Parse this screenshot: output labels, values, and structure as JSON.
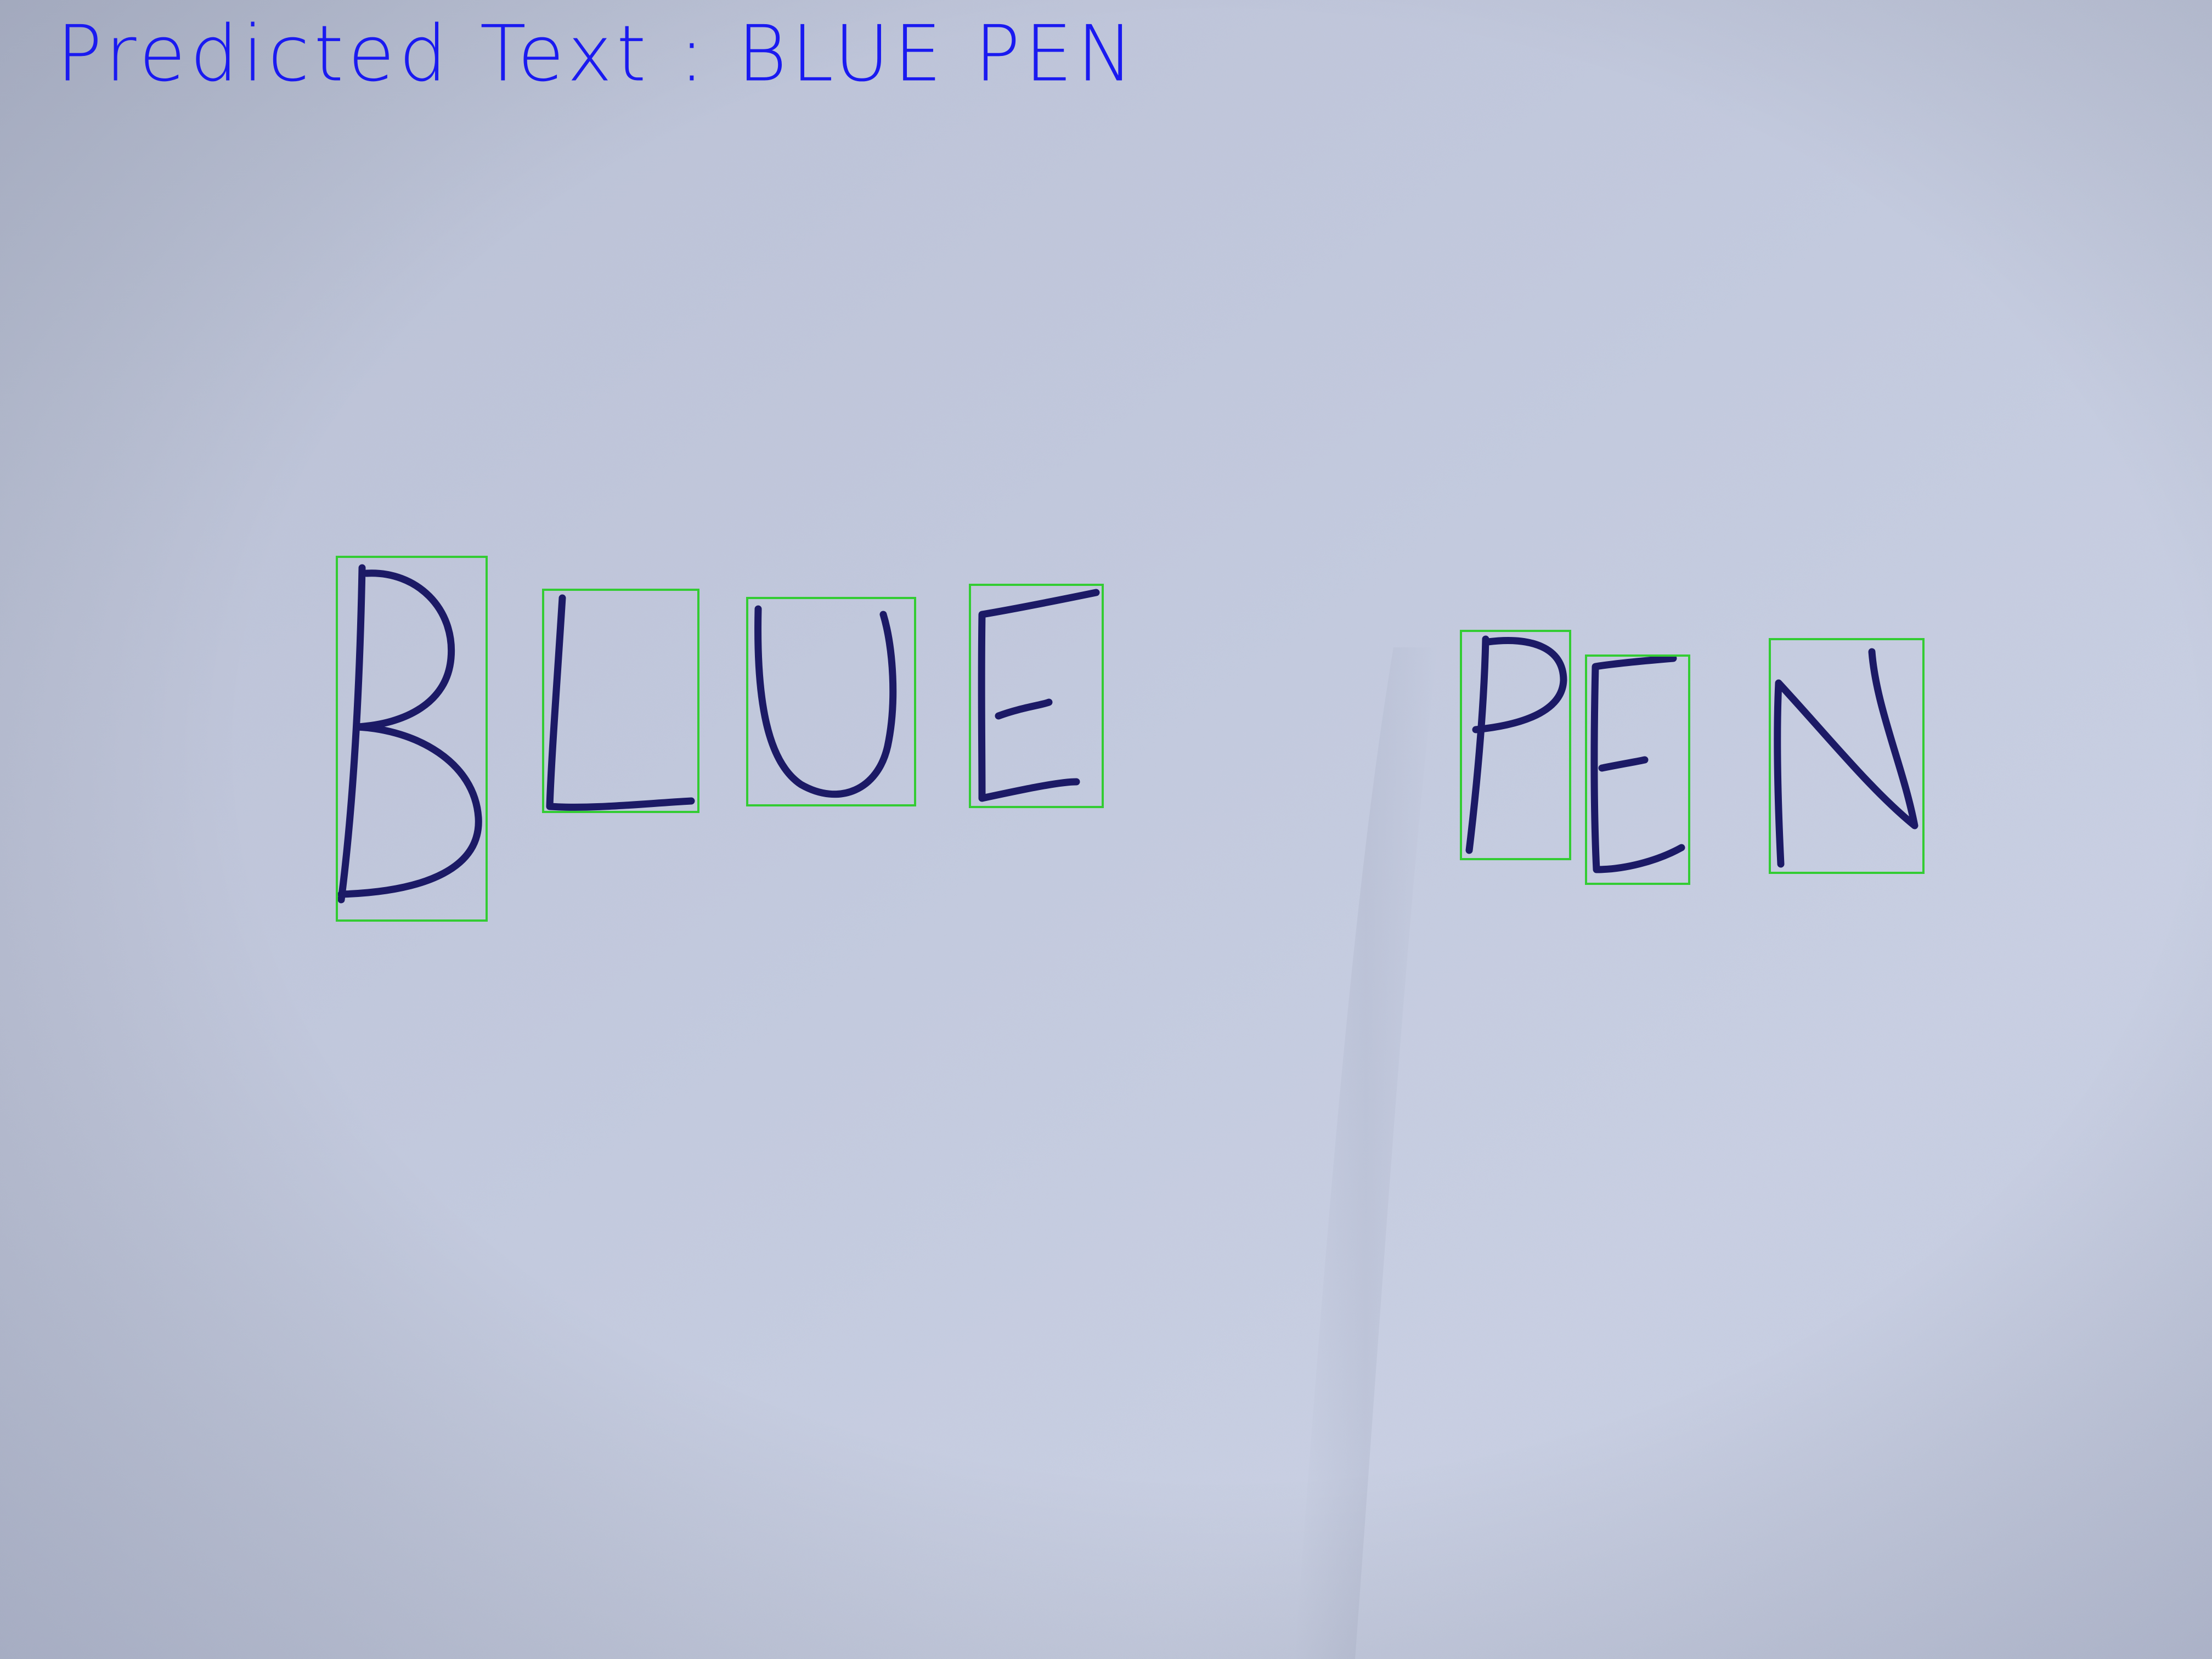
{
  "overlay": {
    "prediction_label": "Predicted Text : BLUE PEN",
    "label_color": "#1a1af0"
  },
  "detections": [
    {
      "character": "B"
    },
    {
      "character": "L"
    },
    {
      "character": "U"
    },
    {
      "character": "E"
    },
    {
      "character": "P"
    },
    {
      "character": "E"
    },
    {
      "character": "N"
    }
  ],
  "colors": {
    "paper_light": "#c4cbe0",
    "paper_dark": "#a6adc2",
    "ink": "#1c1a66",
    "box_outline": "#33cc33"
  }
}
